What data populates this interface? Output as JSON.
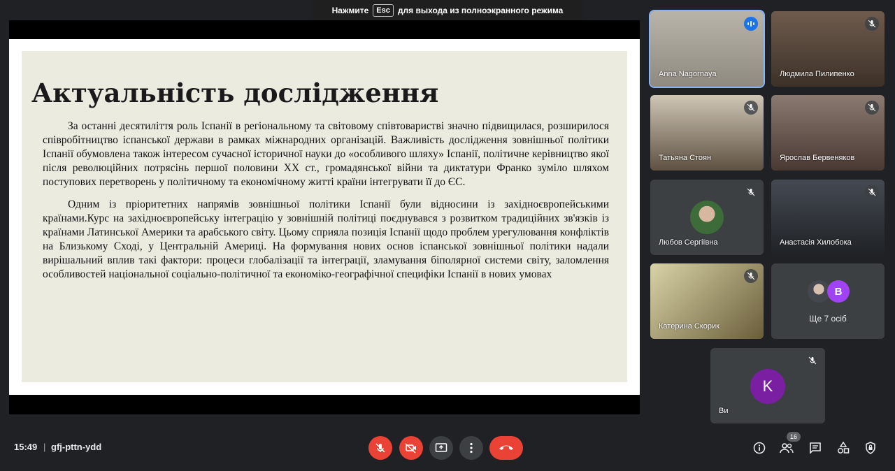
{
  "banner": {
    "prefix": "Нажмите",
    "key": "Esc",
    "suffix": "для выхода из полноэкранного режима"
  },
  "slide": {
    "title": "Актуальність дослідження",
    "paragraphs": [
      "За останні десятиліття роль Іспанії в регіональному та світовому співтоваристві значно підвищилася, розширилося співробітництво іспанської держави в рамках міжнародних організацій. Важливість дослідження зовнішньої політики Іспанії обумовлена також інтересом сучасної історичної науки до «особливого шляху» Іспанії, політичне керівництво якої після революційних потрясінь першої половини XX ст., громадянської війни та диктатури Франко зуміло шляхом поступових перетворень у політичному та економічному житті країни інтегрувати її до ЄС.",
      "Одним із пріоритетних напрямів зовнішньої політики Іспанії були відносини із західноєвропейськими країнами.Курс на західноєвропейську інтеграцію у зовнішній політиці поєднувався з розвитком традиційних зв'язків із країнами Латинської Америки та арабського світу. Цьому сприяла позиція Іспанії щодо проблем урегулювання конфліктів на Близькому Сході, у Центральній Америці. На формування нових основ іспанської зовнішньої політики надали вирішальний вплив такі фактори: процеси глобалізації та інтеграції, зламування біполярної системи світу, заломлення особливостей національної соціально-політичної та економіко-географічної специфіки Іспанії в нових умовах"
    ]
  },
  "participants": [
    {
      "name": "Anna Nagornaya",
      "state": "speaking",
      "color": "#a8a39a"
    },
    {
      "name": "Людмила Пилипенко",
      "state": "muted",
      "color": "#5a4a3e"
    },
    {
      "name": "Татьяна Стоян",
      "state": "muted",
      "color": "#7a6a58"
    },
    {
      "name": "Ярослав Бервеняков",
      "state": "muted",
      "color": "#6b4f45"
    },
    {
      "name": "Любов Сергіївна",
      "state": "muted",
      "color": "#3c4043"
    },
    {
      "name": "Анастасія Хилобока",
      "state": "muted",
      "color": "#2e3135"
    },
    {
      "name": "Катерина Скорик",
      "state": "muted",
      "color": "#8d8560"
    }
  ],
  "more": {
    "label": "Ще 7 осіб",
    "avatar_letter": "В",
    "avatar_color": "#a142f4"
  },
  "self": {
    "name": "Ви",
    "letter": "K",
    "color": "#7b1fa2"
  },
  "bottom": {
    "time": "15:49",
    "separator": "|",
    "meeting_code": "gfj-pttn-ydd",
    "people_count": "16",
    "icons": [
      "mic-off-icon",
      "camera-off-icon",
      "present-icon",
      "more-options-icon",
      "hang-up-icon",
      "info-icon",
      "people-icon",
      "chat-icon",
      "activities-icon",
      "host-controls-icon"
    ]
  },
  "colors": {
    "background": "#202124",
    "tile": "#3c4043",
    "danger": "#ea4335",
    "speaking": "#1a73e8"
  }
}
